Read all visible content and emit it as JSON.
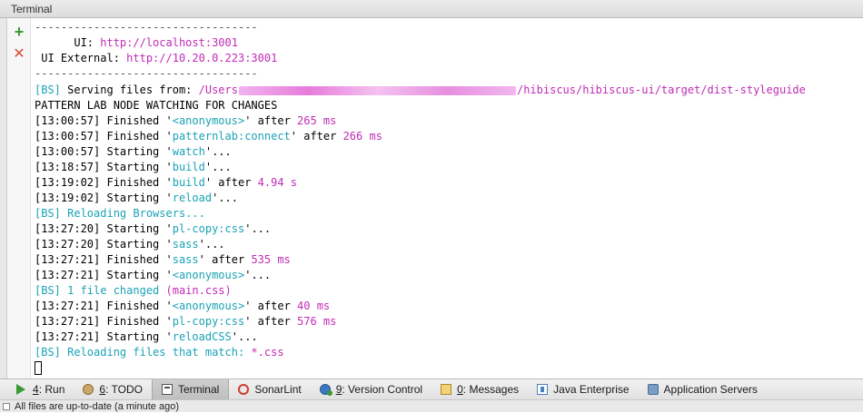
{
  "window": {
    "title": "Terminal"
  },
  "terminal": {
    "separator": "----------------------------------",
    "ui_label": "      UI: ",
    "ui_url": "http://localhost:3001",
    "ui_ext_label": " UI External: ",
    "ui_ext_url": "http://10.20.0.223:3001",
    "serving_prefix": "[BS]",
    "serving_text": " Serving files from: ",
    "serving_path_start": "/Users",
    "serving_path_end": "/hibiscus/hibiscus-ui/target/dist-styleguide",
    "watching": "PATTERN LAB NODE WATCHING FOR CHANGES",
    "log": [
      {
        "time": "[13:00:57]",
        "verb": " Finished '",
        "task": "<anonymous>",
        "mid": "' after ",
        "dur": "265 ms",
        "tail": ""
      },
      {
        "time": "[13:00:57]",
        "verb": " Finished '",
        "task": "patternlab:connect",
        "mid": "' after ",
        "dur": "266 ms",
        "tail": ""
      },
      {
        "time": "[13:00:57]",
        "verb": " Starting '",
        "task": "watch",
        "mid": "'...",
        "dur": "",
        "tail": ""
      },
      {
        "time": "[13:18:57]",
        "verb": " Starting '",
        "task": "build",
        "mid": "'...",
        "dur": "",
        "tail": ""
      },
      {
        "time": "[13:19:02]",
        "verb": " Finished '",
        "task": "build",
        "mid": "' after ",
        "dur": "4.94 s",
        "tail": ""
      },
      {
        "time": "[13:19:02]",
        "verb": " Starting '",
        "task": "reload",
        "mid": "'...",
        "dur": "",
        "tail": ""
      }
    ],
    "reloading_prefix": "[BS]",
    "reloading_text": " Reloading Browsers...",
    "log2": [
      {
        "time": "[13:27:20]",
        "verb": " Starting '",
        "task": "pl-copy:css",
        "mid": "'...",
        "dur": ""
      },
      {
        "time": "[13:27:20]",
        "verb": " Starting '",
        "task": "sass",
        "mid": "'...",
        "dur": ""
      },
      {
        "time": "[13:27:21]",
        "verb": " Finished '",
        "task": "sass",
        "mid": "' after ",
        "dur": "535 ms"
      },
      {
        "time": "[13:27:21]",
        "verb": " Starting '",
        "task": "<anonymous>",
        "mid": "'...",
        "dur": ""
      }
    ],
    "changed_prefix": "[BS]",
    "changed_text": " 1 file changed ",
    "changed_file": "(main.css)",
    "log3": [
      {
        "time": "[13:27:21]",
        "verb": " Finished '",
        "task": "<anonymous>",
        "mid": "' after ",
        "dur": "40 ms"
      },
      {
        "time": "[13:27:21]",
        "verb": " Finished '",
        "task": "pl-copy:css",
        "mid": "' after ",
        "dur": "576 ms"
      },
      {
        "time": "[13:27:21]",
        "verb": " Starting '",
        "task": "reloadCSS",
        "mid": "'...",
        "dur": ""
      }
    ],
    "match_prefix": "[BS]",
    "match_text": " Reloading files that match: ",
    "match_pattern": "*.css"
  },
  "toolwindows": [
    {
      "num": "4",
      "rest": ": Run",
      "icon": "run-icon"
    },
    {
      "num": "6",
      "rest": ": TODO",
      "icon": "todo-icon"
    },
    {
      "num": "",
      "rest": "Terminal",
      "icon": "terminal-icon"
    },
    {
      "num": "",
      "rest": "SonarLint",
      "icon": "sonarlint-icon"
    },
    {
      "num": "9",
      "rest": ": Version Control",
      "icon": "version-control-icon"
    },
    {
      "num": "0",
      "rest": ": Messages",
      "icon": "messages-icon"
    },
    {
      "num": "",
      "rest": "Java Enterprise",
      "icon": "java-enterprise-icon"
    },
    {
      "num": "",
      "rest": "Application Servers",
      "icon": "application-servers-icon"
    }
  ],
  "status": {
    "text": "All files are up-to-date (a minute ago)"
  },
  "colors": {
    "magenta": "#c02cb6",
    "cyan": "#1aa3b5",
    "run_green": "#3a9a35",
    "close_red": "#d94a3a"
  }
}
